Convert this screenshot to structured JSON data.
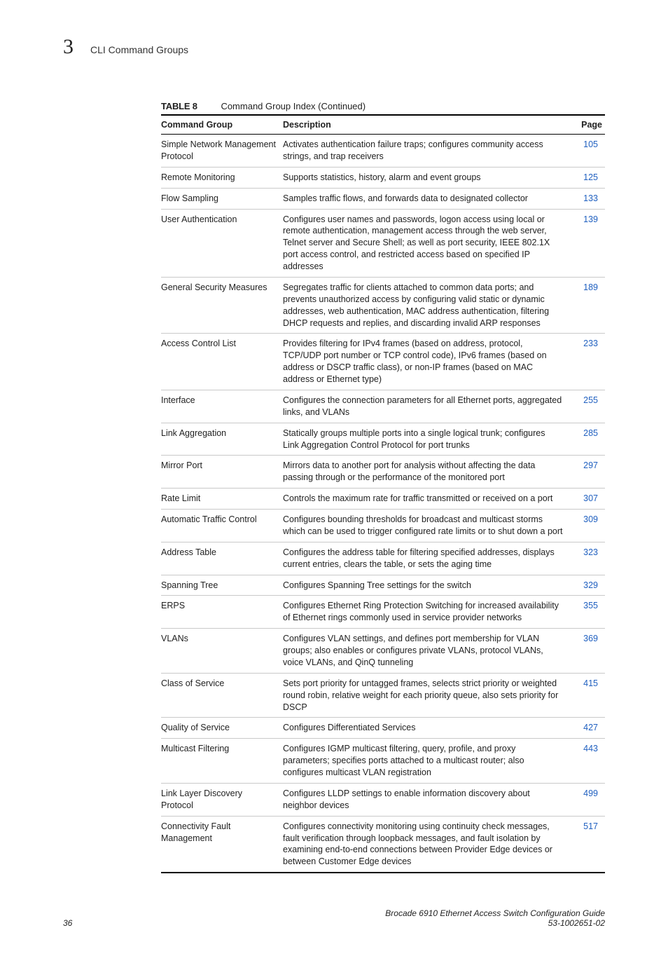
{
  "header": {
    "chapter_number": "3",
    "chapter_title": "CLI Command Groups"
  },
  "table": {
    "number": "TABLE 8",
    "title": "Command Group Index (Continued)",
    "columns": {
      "group": "Command Group",
      "desc": "Description",
      "page": "Page"
    },
    "rows": [
      {
        "group": "Simple Network Management Protocol",
        "desc": "Activates authentication failure traps; configures community access strings, and trap receivers",
        "page": "105"
      },
      {
        "group": "Remote Monitoring",
        "desc": "Supports statistics, history, alarm and event groups",
        "page": "125"
      },
      {
        "group": "Flow Sampling",
        "desc": "Samples traffic flows, and forwards data to designated collector",
        "page": "133"
      },
      {
        "group": "User Authentication",
        "desc": "Configures user names and passwords, logon access using local or remote authentication, management access through the web server, Telnet server and Secure Shell; as well as port security, IEEE 802.1X port access control, and restricted access based on specified IP addresses",
        "page": "139"
      },
      {
        "group": "General Security Measures",
        "desc": "Segregates traffic for clients attached to common data ports; and prevents unauthorized access by configuring valid static or dynamic addresses, web authentication, MAC address authentication, filtering DHCP requests and replies, and discarding invalid ARP responses",
        "page": "189"
      },
      {
        "group": "Access Control List",
        "desc": "Provides filtering for IPv4 frames (based on address, protocol, TCP/UDP port number or TCP control code), IPv6 frames (based on address or DSCP traffic class), or non-IP frames (based on MAC address or Ethernet type)",
        "page": "233"
      },
      {
        "group": "Interface",
        "desc": "Configures the connection parameters for all Ethernet ports, aggregated links, and VLANs",
        "page": "255"
      },
      {
        "group": "Link Aggregation",
        "desc": "Statically groups multiple ports into a single logical trunk; configures Link Aggregation Control Protocol for port trunks",
        "page": "285"
      },
      {
        "group": "Mirror Port",
        "desc": "Mirrors data to another port for analysis without affecting the data passing through or the performance of the monitored port",
        "page": "297"
      },
      {
        "group": "Rate Limit",
        "desc": "Controls the maximum rate for traffic transmitted or received on a port",
        "page": "307"
      },
      {
        "group": "Automatic Traffic Control",
        "desc": "Configures bounding thresholds for broadcast and multicast storms which can be used to trigger configured rate limits or to shut down a port",
        "page": "309"
      },
      {
        "group": "Address Table",
        "desc": "Configures the address table for filtering specified addresses, displays current entries, clears the table, or sets the aging time",
        "page": "323"
      },
      {
        "group": "Spanning Tree",
        "desc": "Configures Spanning Tree settings for the switch",
        "page": "329"
      },
      {
        "group": "ERPS",
        "desc": "Configures Ethernet Ring Protection Switching for increased availability of Ethernet rings commonly used in service provider networks",
        "page": "355"
      },
      {
        "group": "VLANs",
        "desc": "Configures VLAN settings, and defines port membership for VLAN groups; also enables or configures private VLANs, protocol VLANs, voice VLANs, and QinQ tunneling",
        "page": "369"
      },
      {
        "group": "Class of Service",
        "desc": "Sets port priority for untagged frames, selects strict priority or weighted round robin, relative weight for each priority queue, also sets priority for DSCP",
        "page": "415"
      },
      {
        "group": "Quality of Service",
        "desc": "Configures Differentiated Services",
        "page": "427"
      },
      {
        "group": "Multicast Filtering",
        "desc": "Configures IGMP multicast filtering, query, profile, and proxy parameters; specifies ports attached to a multicast router; also configures multicast VLAN registration",
        "page": "443"
      },
      {
        "group": "Link Layer Discovery Protocol",
        "desc": "Configures LLDP settings to enable information discovery about neighbor devices",
        "page": "499"
      },
      {
        "group": "Connectivity Fault Management",
        "desc": "Configures connectivity monitoring using continuity check messages, fault verification through loopback messages, and fault isolation by examining end-to-end connections between Provider Edge devices or between Customer Edge devices",
        "page": "517"
      }
    ]
  },
  "footer": {
    "page_number": "36",
    "doc_title": "Brocade 6910 Ethernet Access Switch Configuration Guide",
    "doc_number": "53-1002651-02"
  }
}
